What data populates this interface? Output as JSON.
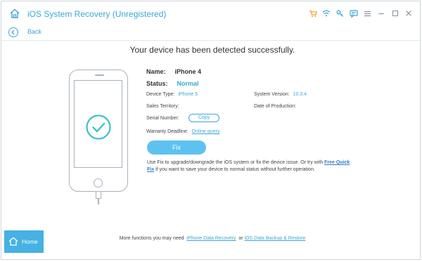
{
  "window": {
    "title": "iOS System Recovery (Unregistered)"
  },
  "titlebar_icons": [
    "cart-icon",
    "wifi-icon",
    "key-icon",
    "chat-icon",
    "menu-icon",
    "minimize-icon",
    "maximize-icon",
    "close-icon"
  ],
  "nav": {
    "back_label": "Back"
  },
  "headline": "Your device has been detected successfully.",
  "device": {
    "name_label": "Name:",
    "name_value": "iPhone 4",
    "status_label": "Status:",
    "status_value": "Normal",
    "type_label": "Device Type:",
    "type_value": "iPhone 5",
    "system_version_label": "System Version:",
    "system_version_value": "10.3.4",
    "sales_territory_label": "Sales Territory:",
    "date_of_production_label": "Date of Production:",
    "serial_number_label": "Serial Number:",
    "copy_label": "Copy",
    "warranty_label": "Warranty Deadline:",
    "warranty_link": "Online query"
  },
  "fix_button": "Fix",
  "description": {
    "part1": "Use Fix to upgrade/downgrade the iOS system or fix the device issue. Or try with ",
    "link_part1": "Free Quick",
    "link_part2": "Fix",
    "part2": " if you want to save your device to normal status without further operation."
  },
  "bottom": {
    "prefix": "More functions you may need",
    "link1": "iPhone Data Recovery",
    "or": "or",
    "link2": "iOS Data Backup & Restore",
    "home_label": "Home"
  },
  "colors": {
    "accent": "#3aa7d8",
    "fix_button": "#5ec2f0",
    "home_button": "#46b1e2",
    "cart": "#f0a52e"
  }
}
